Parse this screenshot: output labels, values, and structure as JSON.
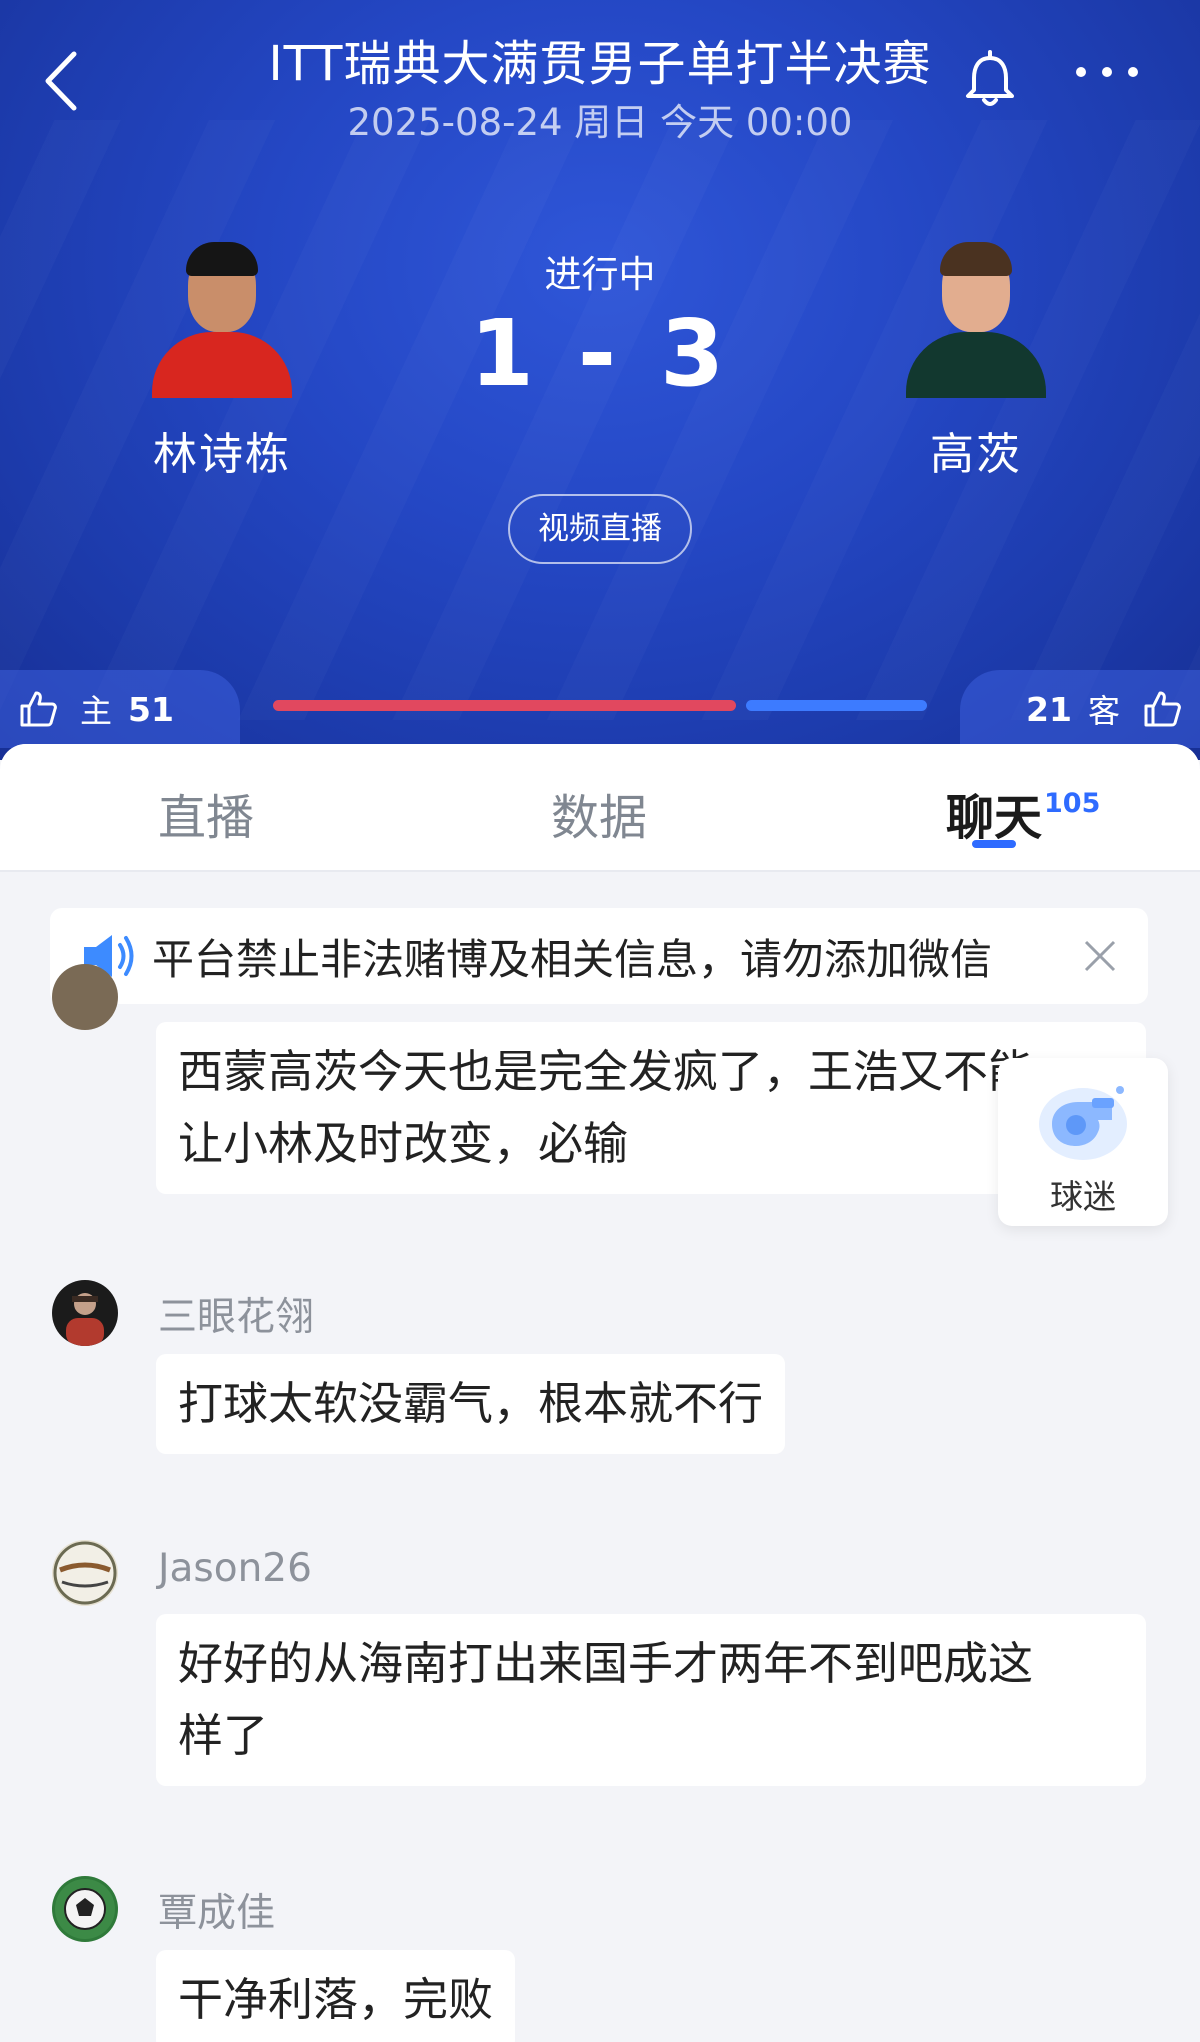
{
  "header": {
    "title": "ITT瑞典大满贯男子单打半决赛",
    "subtitle": "2025-08-24 周日 今天 00:00"
  },
  "match": {
    "status": "进行中",
    "score": "1 - 3",
    "live_button": "视频直播",
    "home": {
      "name": "林诗栋",
      "jersey_color": "#d8261f"
    },
    "away": {
      "name": "高茨",
      "jersey_color": "#12382f"
    }
  },
  "votes": {
    "home_label": "主",
    "home_count": "51",
    "away_label": "客",
    "away_count": "21",
    "home_share": 0.708,
    "home_color": "#e1485f",
    "away_color": "#3d7bff"
  },
  "tabs": [
    {
      "label": "直播"
    },
    {
      "label": "数据"
    },
    {
      "label": "聊天",
      "badge": "105",
      "active": true
    }
  ],
  "notice": {
    "text": "平台禁止非法赌博及相关信息，请勿添加微信"
  },
  "fan_button": {
    "label": "球迷"
  },
  "chat": [
    {
      "user": "",
      "line1": "西蒙高茨今天也是完全发疯了，王浩又不能",
      "line2": "让小林及时改变，必输"
    },
    {
      "user": "三眼花翎",
      "line1": "打球太软没霸气，根本就不行"
    },
    {
      "user": "Jason26",
      "line1": "好好的从海南打出来国手才两年不到吧成这",
      "line2": "样了"
    },
    {
      "user": "覃成佳",
      "line1": "干净利落，完败"
    }
  ],
  "colors": {
    "accent": "#2e6bff",
    "hero_bg": "#2447c4"
  }
}
